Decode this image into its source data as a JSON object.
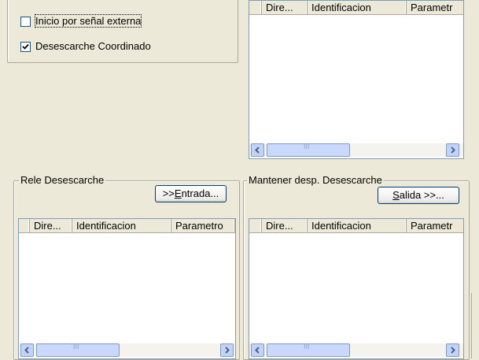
{
  "options": {
    "external_signal_label": "Inicio por señal externa",
    "external_signal_checked": false,
    "coordinated_label": "Desescarche Coordinado",
    "coordinated_checked": true
  },
  "columns": [
    "Dire...",
    "Identificacion",
    "Parametr"
  ],
  "rele_group": {
    "title": "Rele Desescarche",
    "button_prefix": ">>",
    "button_accel": "E",
    "button_rest": "ntrada...",
    "columns": [
      "Dire...",
      "Identificacion",
      "Parametro"
    ]
  },
  "mantener_group": {
    "title": "Mantener desp. Desescarche",
    "button_accel": "S",
    "button_rest": "alida >>..."
  },
  "scroll_grip": "III"
}
